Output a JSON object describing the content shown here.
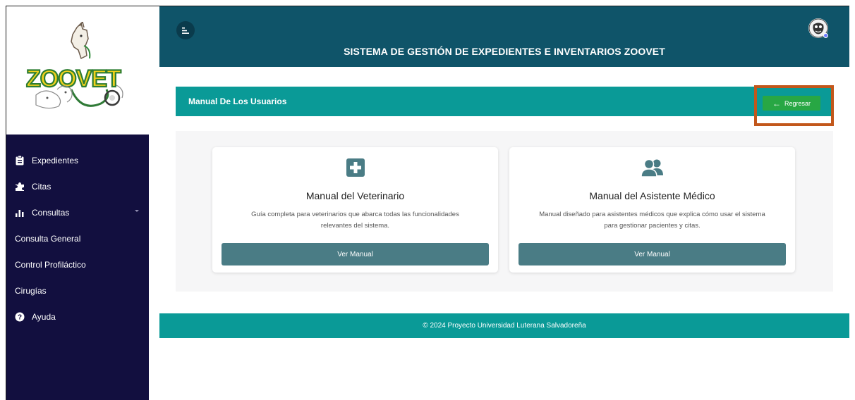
{
  "sidebar": {
    "logo_text": "ZOOVET",
    "items": [
      {
        "label": "Expedientes",
        "icon": "clipboard-icon"
      },
      {
        "label": "Citas",
        "icon": "puzzle-icon"
      },
      {
        "label": "Consultas",
        "icon": "bar-chart-icon"
      },
      {
        "label": "Consulta General"
      },
      {
        "label": "Control Profiláctico"
      },
      {
        "label": "Cirugías"
      },
      {
        "label": "Ayuda",
        "icon": "question-circle-icon"
      }
    ]
  },
  "header": {
    "title": "SISTEMA DE GESTIÓN DE EXPEDIENTES E INVENTARIOS ZOOVET"
  },
  "section": {
    "title": "Manual De Los Usuarios",
    "back_label": "Regresar"
  },
  "cards": [
    {
      "icon": "medical-plus-icon",
      "title": "Manual del Veterinario",
      "desc_line1": "Guía completa para veterinarios que abarca todas las funcionalidades",
      "desc_line2": "relevantes del sistema.",
      "button": "Ver Manual"
    },
    {
      "icon": "users-icon",
      "title": "Manual del Asistente Médico",
      "desc_line1": "Manual diseñado para asistentes médicos que explica cómo usar el sistema",
      "desc_line2": "para gestionar pacientes y citas.",
      "button": "Ver Manual"
    }
  ],
  "footer": {
    "text": "© 2024 Proyecto Universidad Luterana Salvadoreña"
  },
  "colors": {
    "sidebar": "#120f3f",
    "header": "#0f5469",
    "teal": "#0a9a97",
    "button_green": "#28a744",
    "card_button": "#4a7c85",
    "highlight": "#c2571b"
  }
}
